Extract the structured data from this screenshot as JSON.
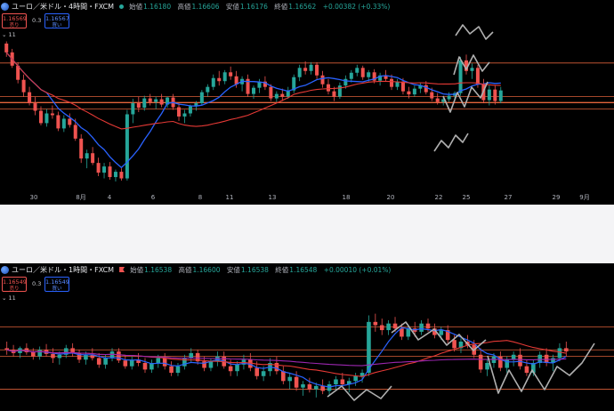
{
  "panels": [
    {
      "symbol": "ユーロ／米ドル・4時間・FXCM",
      "ohlc": [
        {
          "k": "始値",
          "v": "1.16180"
        },
        {
          "k": "高値",
          "v": "1.16606"
        },
        {
          "k": "安値",
          "v": "1.16176"
        },
        {
          "k": "終値",
          "v": "1.16562"
        },
        {
          "k": "",
          "v": "+0.00382 (+0.33%)"
        }
      ],
      "sell_price": "1.16569",
      "sell_label": "売り",
      "spread": "0.3",
      "buy_price": "1.16567",
      "buy_label": "買い",
      "indicator_toggle": "⌄ 11"
    },
    {
      "symbol": "ユーロ／米ドル・1時間・FXCM",
      "ohlc": [
        {
          "k": "始値",
          "v": "1.16538"
        },
        {
          "k": "高値",
          "v": "1.16600"
        },
        {
          "k": "安値",
          "v": "1.16538"
        },
        {
          "k": "終値",
          "v": "1.16548"
        },
        {
          "k": "",
          "v": "+0.00010 (+0.01%)"
        }
      ],
      "sell_price": "1.16549",
      "sell_label": "売り",
      "spread": "0.3",
      "buy_price": "1.16549",
      "buy_label": "買い",
      "indicator_toggle": "⌄ 11"
    }
  ],
  "chart_data": [
    {
      "type": "candlestick",
      "title": "ユーロ／米ドル・4時間・FXCM",
      "x_tick_labels": [
        "30",
        "8月",
        "4",
        "6",
        "8",
        "11",
        "13",
        "18",
        "20",
        "22",
        "25",
        "27",
        "29",
        "9月"
      ],
      "ylim": [
        1.139,
        1.172
      ],
      "grid": false,
      "colors": {
        "up": "#26a69a",
        "down": "#ef5350",
        "ma_fast": "#2962ff",
        "ma_slow": "#e53935",
        "hline": "#ff7043",
        "drawing": "#b0b0b0"
      },
      "horizontal_lines": [
        1.1666,
        1.159,
        1.1577,
        1.1576,
        1.1562
      ],
      "ohlc": [
        [
          1.171,
          1.1715,
          1.168,
          1.169
        ],
        [
          1.169,
          1.1698,
          1.1655,
          1.166
        ],
        [
          1.166,
          1.1668,
          1.162,
          1.1628
        ],
        [
          1.1628,
          1.164,
          1.159,
          1.16
        ],
        [
          1.16,
          1.1612,
          1.157,
          1.1575
        ],
        [
          1.1575,
          1.159,
          1.1548,
          1.1558
        ],
        [
          1.1558,
          1.1568,
          1.1525,
          1.153
        ],
        [
          1.153,
          1.1562,
          1.1522,
          1.1552
        ],
        [
          1.1552,
          1.157,
          1.154,
          1.1548
        ],
        [
          1.1548,
          1.1556,
          1.1512,
          1.1518
        ],
        [
          1.1518,
          1.1548,
          1.151,
          1.154
        ],
        [
          1.154,
          1.1552,
          1.152,
          1.1526
        ],
        [
          1.1526,
          1.154,
          1.149,
          1.1495
        ],
        [
          1.1495,
          1.1505,
          1.144,
          1.145
        ],
        [
          1.145,
          1.147,
          1.1428,
          1.1462
        ],
        [
          1.1462,
          1.1476,
          1.1435,
          1.144
        ],
        [
          1.144,
          1.1452,
          1.141,
          1.1418
        ],
        [
          1.1418,
          1.144,
          1.1405,
          1.1432
        ],
        [
          1.1432,
          1.1442,
          1.1402,
          1.1408
        ],
        [
          1.1408,
          1.1425,
          1.1398,
          1.142
        ],
        [
          1.142,
          1.1428,
          1.14,
          1.1405
        ],
        [
          1.1405,
          1.156,
          1.14,
          1.155
        ],
        [
          1.155,
          1.1585,
          1.153,
          1.1575
        ],
        [
          1.1575,
          1.159,
          1.1555,
          1.1565
        ],
        [
          1.1565,
          1.1592,
          1.1558,
          1.1586
        ],
        [
          1.1586,
          1.1596,
          1.157,
          1.1578
        ],
        [
          1.1578,
          1.159,
          1.1562,
          1.1584
        ],
        [
          1.1584,
          1.1596,
          1.1566,
          1.1572
        ],
        [
          1.1572,
          1.159,
          1.1565,
          1.1588
        ],
        [
          1.1588,
          1.1596,
          1.156,
          1.1566
        ],
        [
          1.1566,
          1.1575,
          1.1535,
          1.1545
        ],
        [
          1.1545,
          1.156,
          1.153,
          1.1552
        ],
        [
          1.1552,
          1.1572,
          1.1545,
          1.1568
        ],
        [
          1.1568,
          1.158,
          1.1558,
          1.1575
        ],
        [
          1.1575,
          1.1605,
          1.157,
          1.16
        ],
        [
          1.16,
          1.1618,
          1.159,
          1.1612
        ],
        [
          1.1612,
          1.164,
          1.1605,
          1.1632
        ],
        [
          1.1632,
          1.1648,
          1.1615,
          1.1625
        ],
        [
          1.1625,
          1.165,
          1.1618,
          1.1645
        ],
        [
          1.1645,
          1.1658,
          1.1628,
          1.1636
        ],
        [
          1.1636,
          1.1648,
          1.161,
          1.1618
        ],
        [
          1.1618,
          1.1636,
          1.1602,
          1.163
        ],
        [
          1.163,
          1.164,
          1.159,
          1.1596
        ],
        [
          1.1596,
          1.1615,
          1.1585,
          1.161
        ],
        [
          1.161,
          1.163,
          1.1598,
          1.1624
        ],
        [
          1.1624,
          1.1636,
          1.1605,
          1.1612
        ],
        [
          1.1612,
          1.1618,
          1.158,
          1.1586
        ],
        [
          1.1586,
          1.1602,
          1.1578,
          1.1596
        ],
        [
          1.1596,
          1.1608,
          1.158,
          1.159
        ],
        [
          1.159,
          1.1612,
          1.1585,
          1.1604
        ],
        [
          1.1604,
          1.164,
          1.1598,
          1.1634
        ],
        [
          1.1634,
          1.1662,
          1.1625,
          1.1655
        ],
        [
          1.1655,
          1.167,
          1.164,
          1.1648
        ],
        [
          1.1648,
          1.1668,
          1.164,
          1.1662
        ],
        [
          1.1662,
          1.1668,
          1.163,
          1.1638
        ],
        [
          1.1638,
          1.1648,
          1.161,
          1.1618
        ],
        [
          1.1618,
          1.163,
          1.1595,
          1.1602
        ],
        [
          1.1602,
          1.1612,
          1.158,
          1.159
        ],
        [
          1.159,
          1.1622,
          1.1585,
          1.1615
        ],
        [
          1.1615,
          1.1638,
          1.1608,
          1.163
        ],
        [
          1.163,
          1.165,
          1.1622,
          1.1644
        ],
        [
          1.1644,
          1.1662,
          1.1636,
          1.1655
        ],
        [
          1.1655,
          1.166,
          1.1628,
          1.1634
        ],
        [
          1.1634,
          1.165,
          1.1624,
          1.1645
        ],
        [
          1.1645,
          1.1652,
          1.162,
          1.1626
        ],
        [
          1.1626,
          1.1644,
          1.1615,
          1.1638
        ],
        [
          1.1638,
          1.165,
          1.1625,
          1.163
        ],
        [
          1.163,
          1.164,
          1.1605,
          1.1612
        ],
        [
          1.1612,
          1.163,
          1.1605,
          1.1624
        ],
        [
          1.1624,
          1.1632,
          1.1595,
          1.1602
        ],
        [
          1.1602,
          1.1612,
          1.1586,
          1.1595
        ],
        [
          1.1595,
          1.1615,
          1.159,
          1.1608
        ],
        [
          1.1608,
          1.1622,
          1.1598,
          1.1616
        ],
        [
          1.1616,
          1.1625,
          1.1595,
          1.16
        ],
        [
          1.16,
          1.161,
          1.158,
          1.1586
        ],
        [
          1.1586,
          1.1598,
          1.1572,
          1.1578
        ],
        [
          1.1578,
          1.159,
          1.157,
          1.1584
        ],
        [
          1.1584,
          1.16,
          1.1578,
          1.1592
        ],
        [
          1.1592,
          1.1602,
          1.1582,
          1.1598
        ],
        [
          1.1598,
          1.168,
          1.1592,
          1.1672
        ],
        [
          1.1672,
          1.1685,
          1.164,
          1.1648
        ],
        [
          1.1648,
          1.1665,
          1.163,
          1.1655
        ],
        [
          1.1655,
          1.1662,
          1.161,
          1.1618
        ],
        [
          1.1618,
          1.163,
          1.1575,
          1.1582
        ],
        [
          1.1582,
          1.1615,
          1.157,
          1.1606
        ],
        [
          1.1606,
          1.1615,
          1.1572,
          1.158
        ],
        [
          1.158,
          1.1612,
          1.1575,
          1.1604
        ]
      ]
    },
    {
      "type": "candlestick",
      "title": "ユーロ／米ドル・1時間・FXCM",
      "x_tick_labels": [],
      "ylim": [
        1.157,
        1.17
      ],
      "grid": false,
      "colors": {
        "up": "#26a69a",
        "down": "#ef5350",
        "ma_fast": "#2962ff",
        "ma_slow": "#e53935",
        "ma_long": "#9c27b0",
        "hline": "#ff7043",
        "drawing": "#b0b0b0"
      },
      "horizontal_lines": [
        1.1666,
        1.1638,
        1.163,
        1.159
      ],
      "ohlc": [
        [
          1.164,
          1.1648,
          1.1632,
          1.1638
        ],
        [
          1.1638,
          1.1644,
          1.163,
          1.1634
        ],
        [
          1.1634,
          1.1642,
          1.1628,
          1.164
        ],
        [
          1.164,
          1.1646,
          1.1632,
          1.1635
        ],
        [
          1.1635,
          1.164,
          1.1626,
          1.163
        ],
        [
          1.163,
          1.1642,
          1.1626,
          1.1638
        ],
        [
          1.1638,
          1.1645,
          1.163,
          1.1633
        ],
        [
          1.1633,
          1.164,
          1.1622,
          1.1628
        ],
        [
          1.1628,
          1.1636,
          1.162,
          1.1632
        ],
        [
          1.1632,
          1.1644,
          1.1628,
          1.164
        ],
        [
          1.164,
          1.1646,
          1.163,
          1.1634
        ],
        [
          1.1634,
          1.1638,
          1.1622,
          1.1626
        ],
        [
          1.1626,
          1.1636,
          1.162,
          1.1632
        ],
        [
          1.1632,
          1.164,
          1.1625,
          1.1628
        ],
        [
          1.1628,
          1.1634,
          1.1616,
          1.162
        ],
        [
          1.162,
          1.1632,
          1.1615,
          1.1628
        ],
        [
          1.1628,
          1.164,
          1.1624,
          1.1636
        ],
        [
          1.1636,
          1.164,
          1.1622,
          1.1625
        ],
        [
          1.1625,
          1.1632,
          1.1615,
          1.1618
        ],
        [
          1.1618,
          1.163,
          1.1614,
          1.1626
        ],
        [
          1.1626,
          1.1634,
          1.1618,
          1.1622
        ],
        [
          1.1622,
          1.1628,
          1.161,
          1.1614
        ],
        [
          1.1614,
          1.1626,
          1.161,
          1.1622
        ],
        [
          1.1622,
          1.1632,
          1.1616,
          1.1628
        ],
        [
          1.1628,
          1.1634,
          1.1614,
          1.1618
        ],
        [
          1.1618,
          1.1624,
          1.1606,
          1.161
        ],
        [
          1.161,
          1.1622,
          1.1606,
          1.1618
        ],
        [
          1.1618,
          1.1632,
          1.1614,
          1.1628
        ],
        [
          1.1628,
          1.164,
          1.1622,
          1.1634
        ],
        [
          1.1634,
          1.1638,
          1.162,
          1.1624
        ],
        [
          1.1624,
          1.163,
          1.1612,
          1.1616
        ],
        [
          1.1616,
          1.1628,
          1.1612,
          1.1624
        ],
        [
          1.1624,
          1.1636,
          1.1618,
          1.163
        ],
        [
          1.163,
          1.1636,
          1.1615,
          1.1618
        ],
        [
          1.1618,
          1.1626,
          1.1606,
          1.1612
        ],
        [
          1.1612,
          1.1624,
          1.1606,
          1.162
        ],
        [
          1.162,
          1.1632,
          1.1614,
          1.1626
        ],
        [
          1.1626,
          1.1634,
          1.1612,
          1.1616
        ],
        [
          1.1616,
          1.1624,
          1.1602,
          1.1606
        ],
        [
          1.1606,
          1.1618,
          1.16,
          1.1612
        ],
        [
          1.1612,
          1.1628,
          1.1606,
          1.1622
        ],
        [
          1.1622,
          1.163,
          1.1608,
          1.1612
        ],
        [
          1.1612,
          1.1618,
          1.1596,
          1.16
        ],
        [
          1.16,
          1.161,
          1.159,
          1.1605
        ],
        [
          1.1605,
          1.1612,
          1.1588,
          1.1592
        ],
        [
          1.1592,
          1.16,
          1.1582,
          1.1596
        ],
        [
          1.1596,
          1.1604,
          1.1586,
          1.159
        ],
        [
          1.159,
          1.1598,
          1.158,
          1.1594
        ],
        [
          1.1594,
          1.1602,
          1.1584,
          1.1588
        ],
        [
          1.1588,
          1.16,
          1.1582,
          1.1596
        ],
        [
          1.1596,
          1.1606,
          1.159,
          1.1602
        ],
        [
          1.1602,
          1.161,
          1.1592,
          1.1596
        ],
        [
          1.1596,
          1.1604,
          1.1586,
          1.16
        ],
        [
          1.16,
          1.161,
          1.1594,
          1.1606
        ],
        [
          1.1606,
          1.1614,
          1.1598,
          1.161
        ],
        [
          1.161,
          1.168,
          1.1606,
          1.1672
        ],
        [
          1.1672,
          1.1682,
          1.166,
          1.1668
        ],
        [
          1.1668,
          1.1676,
          1.1656,
          1.1662
        ],
        [
          1.1662,
          1.1674,
          1.1656,
          1.167
        ],
        [
          1.167,
          1.1678,
          1.166,
          1.1664
        ],
        [
          1.1664,
          1.167,
          1.165,
          1.1654
        ],
        [
          1.1654,
          1.1668,
          1.165,
          1.1664
        ],
        [
          1.1664,
          1.1672,
          1.1654,
          1.166
        ],
        [
          1.166,
          1.1674,
          1.1656,
          1.167
        ],
        [
          1.167,
          1.1676,
          1.166,
          1.1664
        ],
        [
          1.1664,
          1.167,
          1.1652,
          1.1656
        ],
        [
          1.1656,
          1.1666,
          1.165,
          1.1662
        ],
        [
          1.1662,
          1.1668,
          1.1646,
          1.165
        ],
        [
          1.165,
          1.1656,
          1.1636,
          1.164
        ],
        [
          1.164,
          1.1652,
          1.1634,
          1.1648
        ],
        [
          1.1648,
          1.1656,
          1.164,
          1.1644
        ],
        [
          1.1644,
          1.165,
          1.1628,
          1.1632
        ],
        [
          1.1632,
          1.164,
          1.161,
          1.1614
        ],
        [
          1.1614,
          1.1626,
          1.1606,
          1.1622
        ],
        [
          1.1622,
          1.1634,
          1.1616,
          1.163
        ],
        [
          1.163,
          1.1636,
          1.1612,
          1.1616
        ],
        [
          1.1616,
          1.163,
          1.161,
          1.1626
        ],
        [
          1.1626,
          1.1636,
          1.1618,
          1.1632
        ],
        [
          1.1632,
          1.164,
          1.1614,
          1.1618
        ],
        [
          1.1618,
          1.1626,
          1.1606,
          1.161
        ],
        [
          1.161,
          1.1626,
          1.1606,
          1.1622
        ],
        [
          1.1622,
          1.1636,
          1.1616,
          1.1632
        ],
        [
          1.1632,
          1.164,
          1.1618,
          1.1622
        ],
        [
          1.1622,
          1.1632,
          1.1612,
          1.1628
        ],
        [
          1.1628,
          1.1646,
          1.1624,
          1.164
        ],
        [
          1.164,
          1.1648,
          1.163,
          1.1636
        ]
      ]
    }
  ]
}
